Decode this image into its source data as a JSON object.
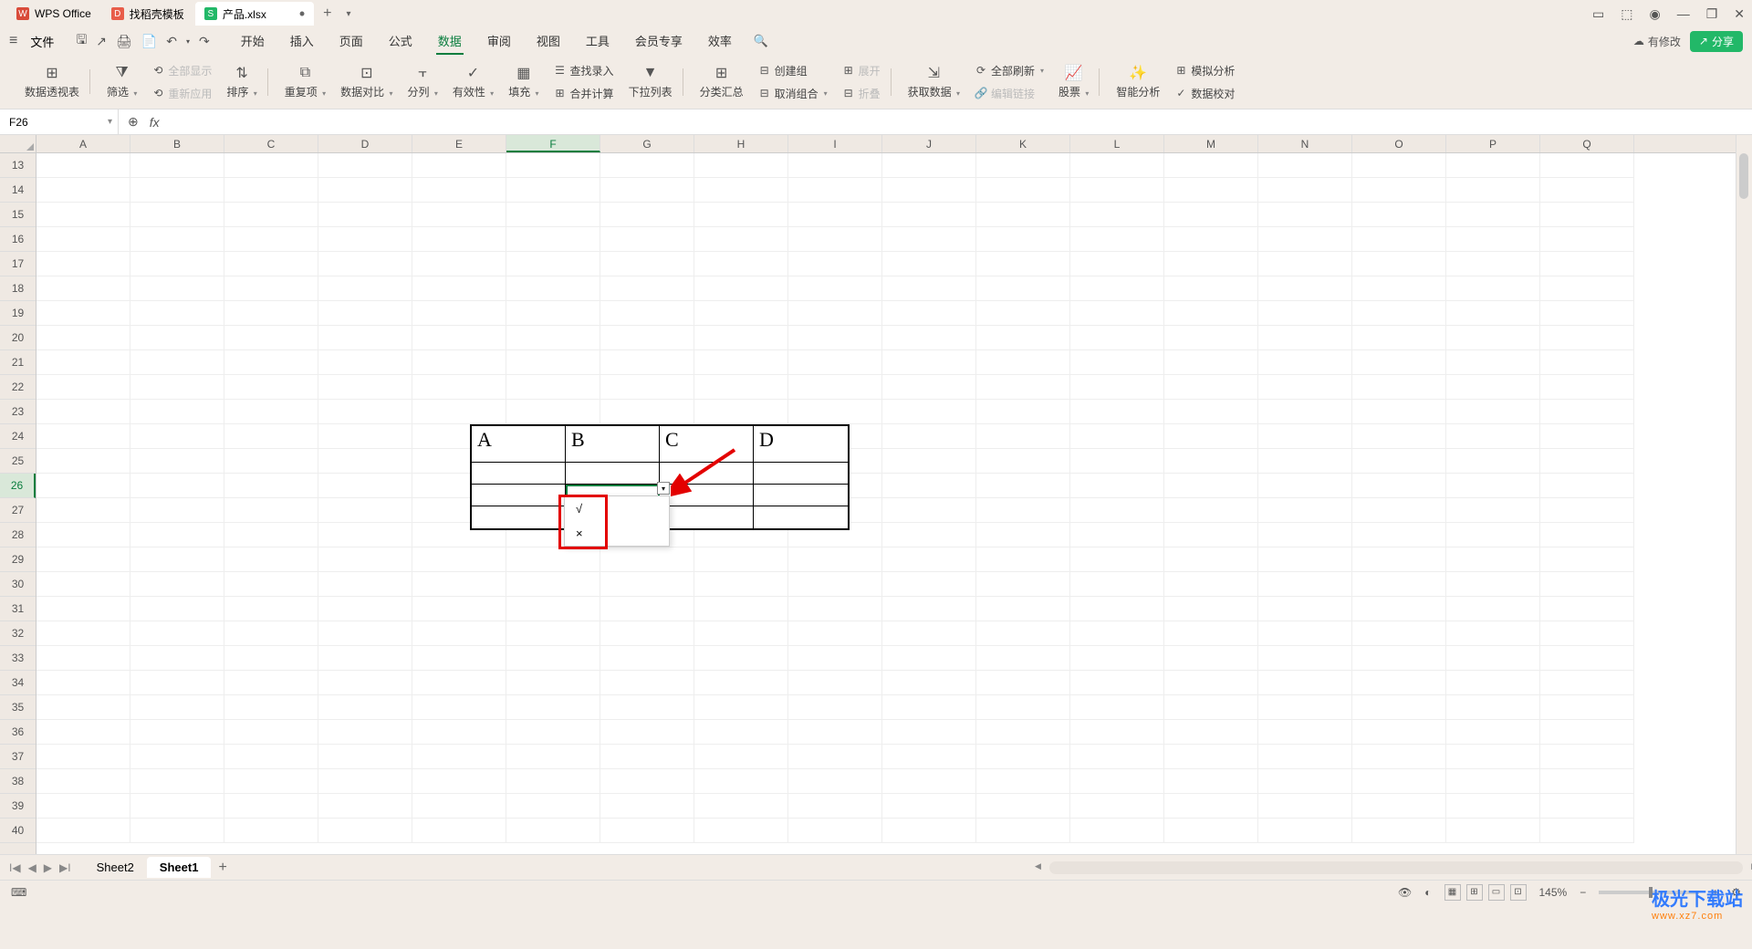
{
  "titlebar": {
    "tabs": [
      {
        "icon_color": "#d94b3a",
        "icon_text": "W",
        "label": "WPS Office"
      },
      {
        "icon_color": "#e85d4a",
        "icon_text": "D",
        "label": "找稻壳模板"
      },
      {
        "icon_color": "#22b868",
        "icon_text": "S",
        "label": "产品.xlsx"
      }
    ],
    "modified": "•",
    "add": "+",
    "window_icons": {
      "layout": "▭",
      "cube": "⬚",
      "user": "◉",
      "min": "—",
      "max": "❐",
      "close": "✕"
    }
  },
  "menubar": {
    "hamburger": "≡",
    "file": "文件",
    "qat": {
      "save": "🖫",
      "export": "↗",
      "print": "🖨",
      "preview": "📄",
      "undo": "↶",
      "redo": "↷"
    },
    "tabs": [
      "开始",
      "插入",
      "页面",
      "公式",
      "数据",
      "审阅",
      "视图",
      "工具",
      "会员专享",
      "效率"
    ],
    "active_tab_index": 4,
    "search_icon": "🔍",
    "changes": "有修改",
    "share": "分享"
  },
  "ribbon": {
    "groups": [
      {
        "items": [
          {
            "icon": "⊞",
            "label": "数据透视表"
          }
        ]
      },
      {
        "items": [
          {
            "icon": "⧩",
            "label": "筛选",
            "dd": true
          },
          {
            "icon": "⟲",
            "label": "全部显示",
            "disabled": true,
            "row": true
          },
          {
            "icon": "⟲",
            "label": "重新应用",
            "disabled": true,
            "row": true
          },
          {
            "icon": "⇅",
            "label": "排序",
            "dd": true
          }
        ]
      },
      {
        "items": [
          {
            "icon": "⧉",
            "label": "重复项",
            "dd": true
          },
          {
            "icon": "⊡",
            "label": "数据对比",
            "dd": true
          },
          {
            "icon": "⫟",
            "label": "分列",
            "dd": true
          },
          {
            "icon": "✓",
            "label": "有效性",
            "dd": true
          },
          {
            "icon": "▦",
            "label": "填充",
            "dd": true
          },
          {
            "icon": "☰",
            "label": "查找录入",
            "row": true
          },
          {
            "icon": "⊞",
            "label": "合并计算",
            "row": true
          },
          {
            "icon": "▼",
            "label": "下拉列表"
          }
        ]
      },
      {
        "items": [
          {
            "icon": "⊞",
            "label": "分类汇总"
          },
          {
            "icon": "⊟",
            "label": "创建组",
            "row": true
          },
          {
            "icon": "⊟",
            "label": "取消组合",
            "dd": true,
            "row": true
          },
          {
            "icon": "⊞",
            "label": "展开",
            "disabled": true,
            "row": true
          },
          {
            "icon": "⊟",
            "label": "折叠",
            "disabled": true,
            "row": true
          }
        ]
      },
      {
        "items": [
          {
            "icon": "⇲",
            "label": "获取数据",
            "dd": true
          },
          {
            "icon": "⟳",
            "label": "全部刷新",
            "dd": true,
            "row": true
          },
          {
            "icon": "🔗",
            "label": "编辑链接",
            "disabled": true,
            "row": true
          },
          {
            "icon": "📈",
            "label": "股票",
            "dd": true
          }
        ]
      },
      {
        "items": [
          {
            "icon": "✨",
            "label": "智能分析"
          },
          {
            "icon": "⊞",
            "label": "模拟分析",
            "row": true
          },
          {
            "icon": "✓",
            "label": "数据校对",
            "row": true
          }
        ]
      }
    ]
  },
  "namebox": {
    "value": "F26"
  },
  "formula_bar": {
    "zoom": "⊕",
    "fx": "fx",
    "value": ""
  },
  "grid": {
    "columns": [
      "A",
      "B",
      "C",
      "D",
      "E",
      "F",
      "G",
      "H",
      "I",
      "J",
      "K",
      "L",
      "M",
      "N",
      "O",
      "P",
      "Q"
    ],
    "selected_col": "F",
    "rows_start": 13,
    "rows_end": 40,
    "selected_row": 26
  },
  "user_table": {
    "headers": [
      "A",
      "B",
      "C",
      "D"
    ]
  },
  "dropdown": {
    "button": "▾",
    "items": [
      "√",
      "×"
    ]
  },
  "sheets": {
    "nav": {
      "first": "I◀",
      "prev": "◀",
      "next": "▶",
      "last": "▶I"
    },
    "tabs": [
      "Sheet2",
      "Sheet1"
    ],
    "active_index": 1,
    "add": "+"
  },
  "statusbar": {
    "ready_icon": "⌨",
    "eye": "👁",
    "theme": "◐",
    "views": [
      "▦",
      "⊞",
      "▭",
      "⊡"
    ],
    "zoom_label": "145%",
    "zoom_minus": "−",
    "zoom_plus": "+",
    "settings": "⚙"
  },
  "watermark": {
    "brand": "极光下载站",
    "url": "www.xz7.com"
  }
}
